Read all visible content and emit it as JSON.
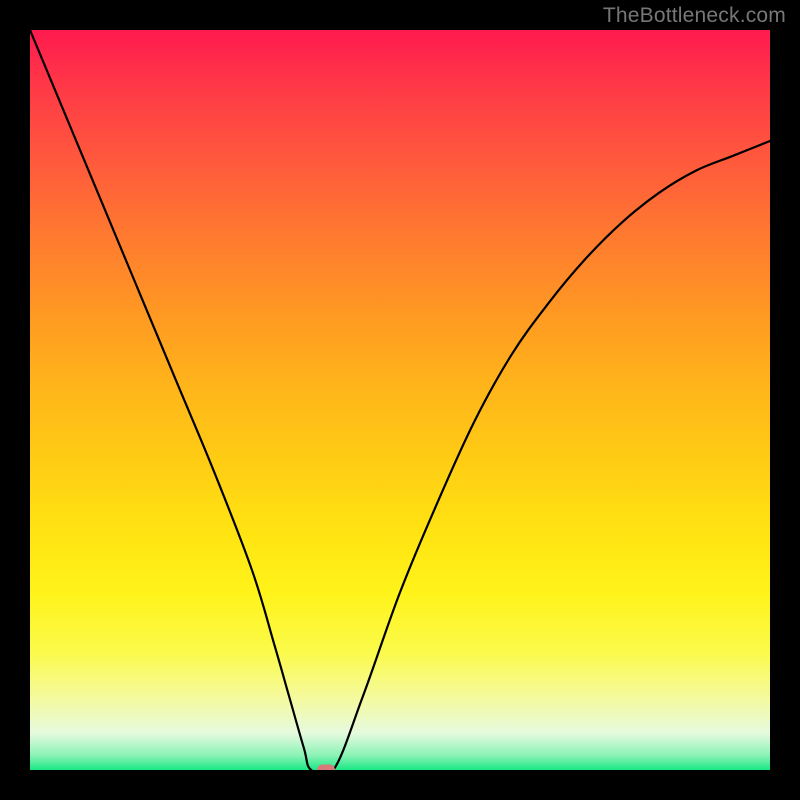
{
  "watermark": "TheBottleneck.com",
  "chart_data": {
    "type": "line",
    "title": "",
    "xlabel": "",
    "ylabel": "",
    "xlim": [
      0,
      100
    ],
    "ylim": [
      0,
      100
    ],
    "grid": false,
    "legend": false,
    "background_gradient": {
      "stops": [
        {
          "pos": 0.0,
          "color": "#ff1a4e"
        },
        {
          "pos": 0.5,
          "color": "#ffb41a"
        },
        {
          "pos": 0.8,
          "color": "#fff31a"
        },
        {
          "pos": 0.95,
          "color": "#e6fadf"
        },
        {
          "pos": 1.0,
          "color": "#19e884"
        }
      ]
    },
    "series": [
      {
        "name": "bottleneck-curve",
        "x": [
          0,
          5,
          10,
          15,
          20,
          25,
          30,
          33,
          35,
          37,
          38,
          41,
          45,
          50,
          55,
          60,
          65,
          70,
          75,
          80,
          85,
          90,
          95,
          100
        ],
        "y": [
          100,
          88,
          76,
          64,
          52,
          40,
          27,
          17,
          10,
          3,
          0,
          0,
          10,
          24,
          36,
          47,
          56,
          63,
          69,
          74,
          78,
          81,
          83,
          85
        ]
      }
    ],
    "annotations": [
      {
        "name": "optimal-marker",
        "shape": "pill",
        "color": "#d97a7a",
        "x": 40,
        "y": 0
      }
    ]
  }
}
